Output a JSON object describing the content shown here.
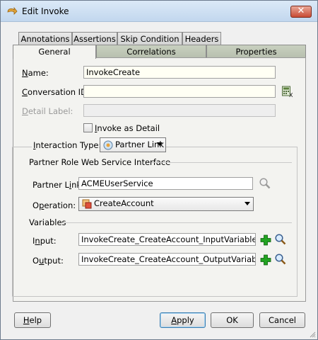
{
  "window": {
    "title": "Edit Invoke",
    "close_label": "✕"
  },
  "tabs": {
    "back_row": [
      {
        "label": "Annotations"
      },
      {
        "label": "Assertions"
      },
      {
        "label": "Skip Condition"
      },
      {
        "label": "Headers"
      }
    ],
    "front_row": [
      {
        "label": "General",
        "active": true
      },
      {
        "label": "Correlations"
      },
      {
        "label": "Properties"
      }
    ]
  },
  "form": {
    "name": {
      "label_mn": "N",
      "label_rest": "ame:",
      "value": "InvokeCreate"
    },
    "conversation_id": {
      "label_mn": "C",
      "label_rest": "onversation ID:",
      "value": ""
    },
    "detail_label": {
      "label_mn": "D",
      "label_rest": "etail Label:",
      "value": ""
    },
    "invoke_as_detail": {
      "label_mn": "I",
      "label_rest": "nvoke as Detail",
      "checked": false
    },
    "interaction_type": {
      "label_mn": "I",
      "label_rest": "nteraction Type:",
      "value": "Partner Link"
    }
  },
  "partner_role": {
    "section_title": "Partner Role Web Service Interface",
    "partner_link": {
      "label_pre": "Partner L",
      "label_mn": "i",
      "label_rest": "nk:",
      "value": "ACMEUserService"
    },
    "operation": {
      "label_pre": "O",
      "label_mn": "p",
      "label_rest": "eration:",
      "value": "CreateAccount"
    }
  },
  "variables": {
    "section_title": "Variables",
    "input": {
      "label_pre": "I",
      "label_mn": "n",
      "label_rest": "put:",
      "value": "InvokeCreate_CreateAccount_InputVariable"
    },
    "output": {
      "label_pre": "O",
      "label_mn": "u",
      "label_rest": "tput:",
      "value": "InvokeCreate_CreateAccount_OutputVariable"
    }
  },
  "buttons": {
    "help": {
      "mn": "H",
      "rest": "elp"
    },
    "apply": {
      "mn": "A",
      "rest": "pply"
    },
    "ok": {
      "label": "OK"
    },
    "cancel": {
      "label": "Cancel"
    }
  },
  "colors": {
    "titlebar": "#c2d7ee",
    "close": "#c84a33",
    "add_icon": "#1d9a1d",
    "panel": "#f3f3f0"
  }
}
